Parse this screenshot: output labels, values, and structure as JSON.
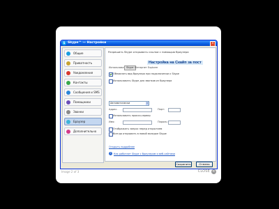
{
  "window": {
    "title": "Skype™ — Настройки",
    "app_icon": "skype-icon"
  },
  "sidebar": {
    "items": [
      {
        "label": "Общие",
        "icon": "skype-logo-icon",
        "color": "#1a9de0"
      },
      {
        "label": "Приватность",
        "icon": "lock-icon",
        "color": "#c8a431"
      },
      {
        "label": "Уведомления",
        "icon": "flag-icon",
        "color": "#d9382c"
      },
      {
        "label": "Контакты",
        "icon": "contacts-icon",
        "color": "#38a84a"
      },
      {
        "label": "Сообщения и SMS",
        "icon": "chat-icon",
        "color": "#2a86d8"
      },
      {
        "label": "Помощники",
        "icon": "helpers-icon",
        "color": "#6a4fb8"
      },
      {
        "label": "Звонки",
        "icon": "phone-icon",
        "color": "#8a8a8a"
      },
      {
        "label": "Браузер",
        "icon": "browser-icon",
        "color": "#3bb3d9"
      },
      {
        "label": "Дополнительно",
        "icon": "advanced-icon",
        "color": "#d33b8a"
      }
    ],
    "active_index": 7
  },
  "content": {
    "header": "Разрешить Skype открывать ссылки с помощью браузера",
    "overlay_title": "Настройка на Скайп за пост",
    "row1_label": "Использовать:",
    "row1_button": "Skype",
    "row1_note": "Интернет Explorer",
    "checkbox1": "Обновлять вид браузера при подключении к Skype",
    "checkbox2": "Использовать Skype для звонков из браузера",
    "select_value": "Автоматически",
    "fields": {
      "label1": "Адрес:",
      "label2": "Порт:",
      "checkbox": "Использовать прокси-сервер",
      "label3": "Имя:",
      "label4": "Пароль:"
    },
    "checkbox3": "Отображать запрос перед открытием",
    "checkbox4": "Всегда открывать в новой вкладке Skype",
    "link1": "Открыть подробнее",
    "help_link": "Как работает Skype с браузером и веб-сайтами"
  },
  "buttons": {
    "save": "Сохранить",
    "cancel": "Отмена"
  },
  "lightbox": {
    "counter": "Image 2 of 3",
    "close": "CLOSE"
  }
}
